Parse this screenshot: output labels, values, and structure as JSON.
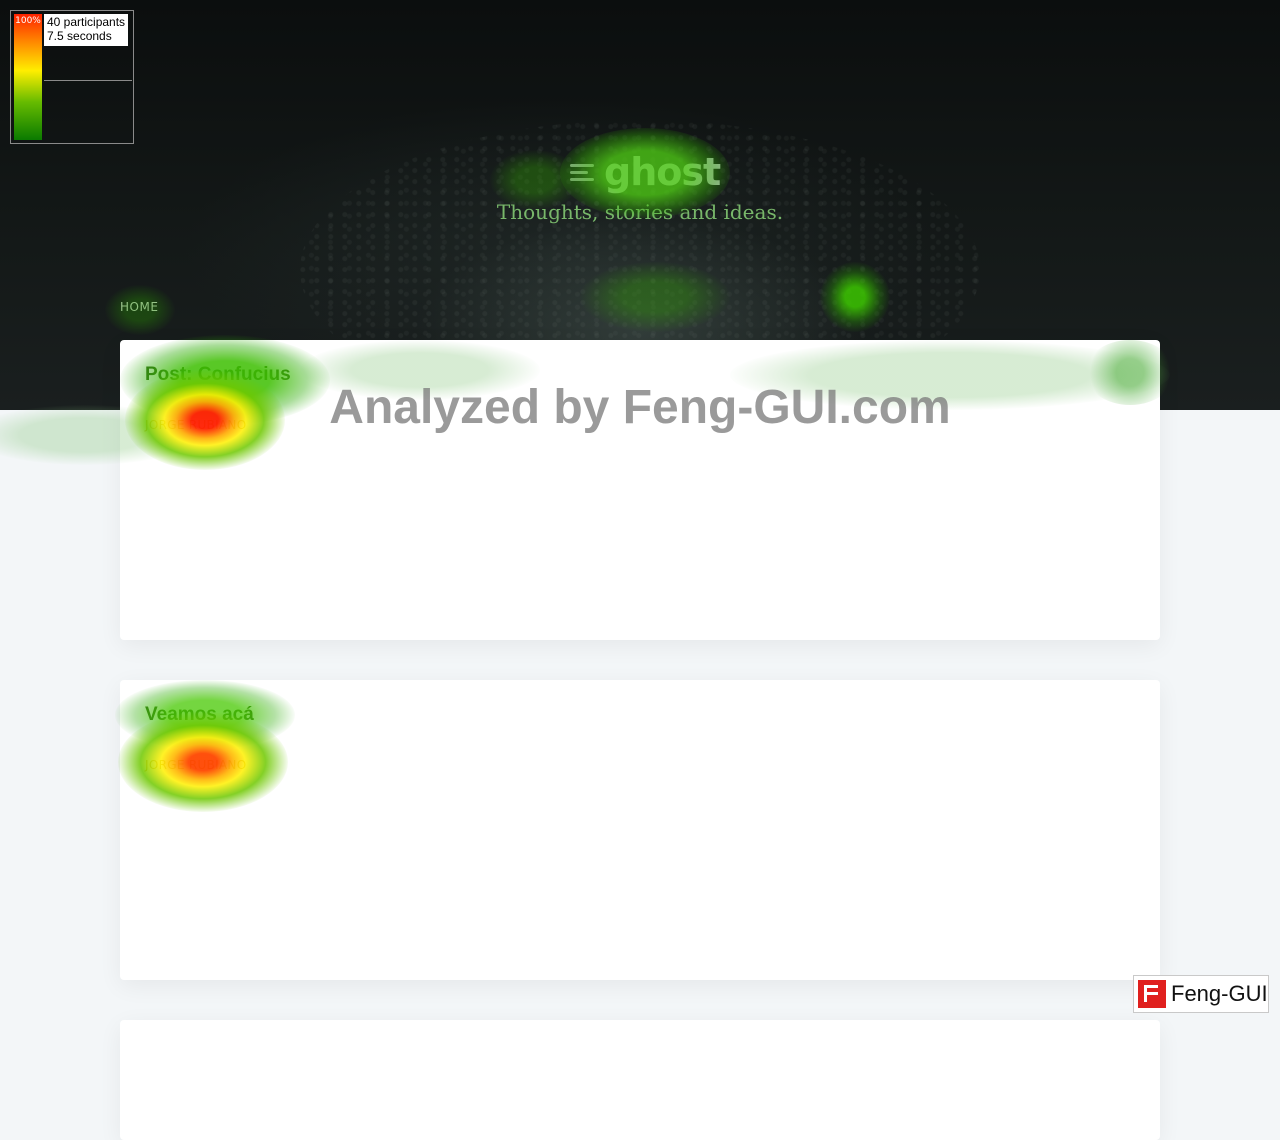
{
  "site": {
    "logo_text": "ghost",
    "tagline": "Thoughts, stories and ideas."
  },
  "nav": {
    "items": [
      {
        "label": "HOME"
      }
    ]
  },
  "posts": [
    {
      "title": "Post: Confucius",
      "author": "JORGE RUBIANO"
    },
    {
      "title": "Veamos acá",
      "author": "JORGE RUBIANO"
    }
  ],
  "overlay": {
    "watermark": "Analyzed by Feng-GUI.com",
    "legend": {
      "max_label": "100%",
      "participants": "40 participants",
      "duration": "7.5 seconds"
    },
    "brand": "Feng-GUI"
  },
  "colors": {
    "heat_high": "#ff2200",
    "heat_mid": "#ffee00",
    "heat_low": "#3aa800"
  }
}
